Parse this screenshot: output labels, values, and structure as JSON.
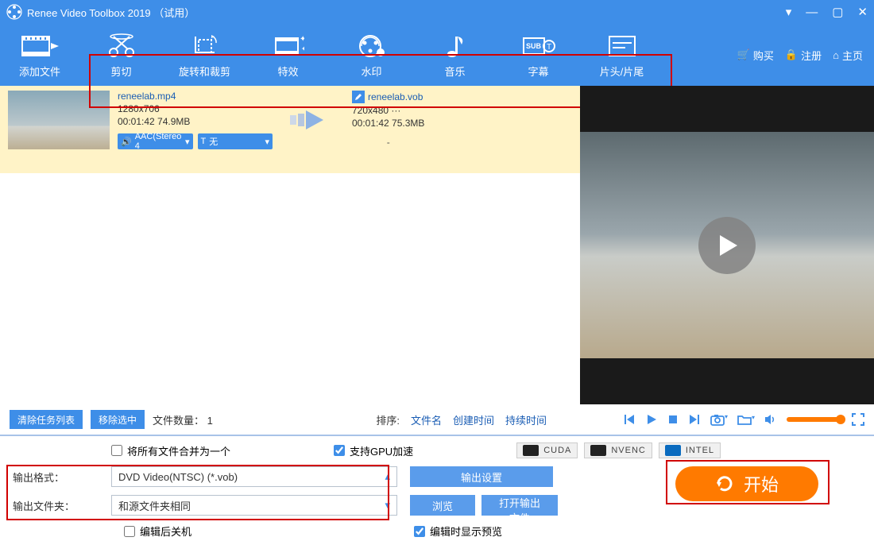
{
  "titlebar": {
    "app_name": "Renee Video Toolbox 2019",
    "trial": "（试用）"
  },
  "toolbar": {
    "add_file": "添加文件",
    "items": [
      {
        "label": "剪切"
      },
      {
        "label": "旋转和裁剪"
      },
      {
        "label": "特效"
      },
      {
        "label": "水印"
      },
      {
        "label": "音乐"
      },
      {
        "label": "字幕"
      },
      {
        "label": "片头/片尾"
      }
    ],
    "right": {
      "buy": "购买",
      "register": "注册",
      "home": "主页"
    }
  },
  "file": {
    "src_name": "reneelab.mp4",
    "src_res": "1280x706",
    "src_dur_size": "00:01:42  74.9MB",
    "audio_pill": "AAC(Stereo 4",
    "text_pill": "无",
    "out_name": "reneelab.vob",
    "out_res": "720x480    ···",
    "out_dur_size": "00:01:42  75.3MB",
    "dash": "-"
  },
  "midbar": {
    "clear_list": "清除任务列表",
    "remove_sel": "移除选中",
    "file_count_label": "文件数量：",
    "file_count_value": "1",
    "sort_label": "排序:",
    "sort_name": "文件名",
    "sort_ctime": "创建时间",
    "sort_dur": "持续时间"
  },
  "bottom": {
    "merge_all": "将所有文件合并为一个",
    "gpu_accel": "支持GPU加速",
    "badges": {
      "cuda": "CUDA",
      "nvenc": "NVENC",
      "intel": "INTEL"
    },
    "out_format_label": "输出格式：",
    "out_format_value": "DVD Video(NTSC) (*.vob)",
    "out_folder_label": "输出文件夹：",
    "out_folder_value": "和源文件夹相同",
    "output_settings": "输出设置",
    "browse": "浏览",
    "open_output": "打开输出文件",
    "shutdown_after": "编辑后关机",
    "show_preview": "编辑时显示预览",
    "start": "开始"
  }
}
